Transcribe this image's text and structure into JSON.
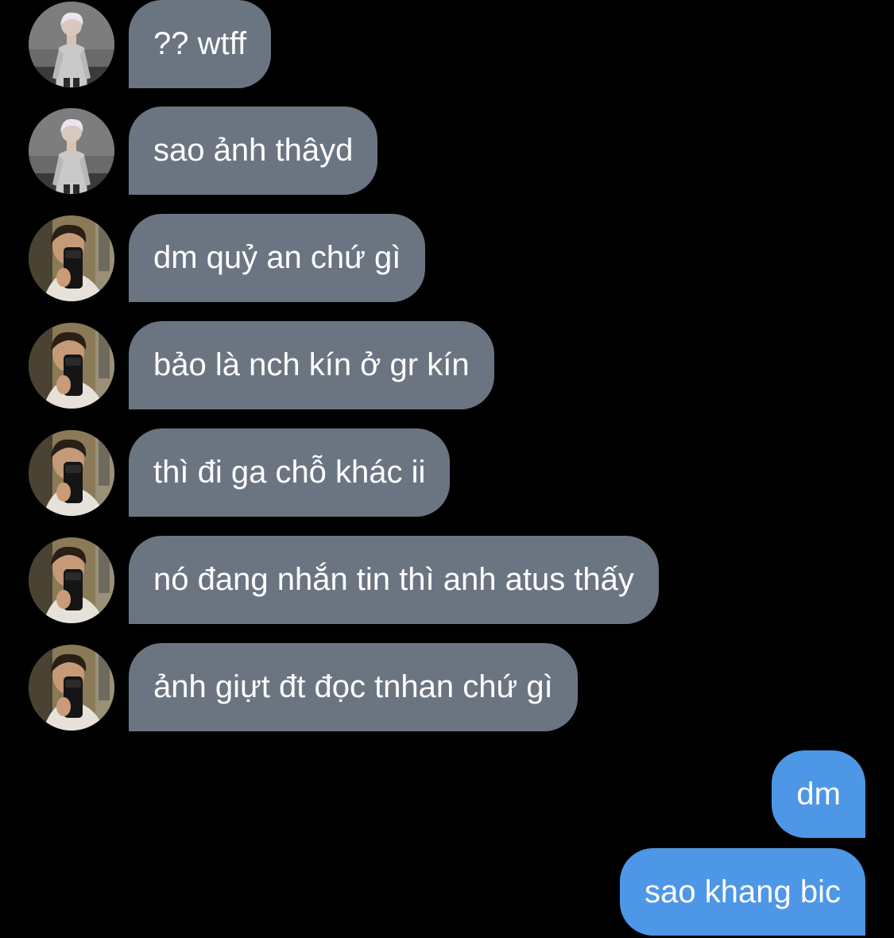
{
  "conversation": {
    "incoming": [
      {
        "text": "?? wtff",
        "avatar": "avatar-white-hair-icon"
      },
      {
        "text": "sao ảnh thâyd",
        "avatar": "avatar-white-hair-icon"
      },
      {
        "text": "dm quỷ an chứ gì",
        "avatar": "avatar-mirror-selfie-icon"
      },
      {
        "text": "bảo là nch kín ở gr kín",
        "avatar": "avatar-mirror-selfie-icon"
      },
      {
        "text": "thì đi ga chỗ khác ii",
        "avatar": "avatar-mirror-selfie-icon"
      },
      {
        "text": "nó đang nhắn tin thì anh atus thấy",
        "avatar": "avatar-mirror-selfie-icon"
      },
      {
        "text": "ảnh giựt đt đọc tnhan chứ gì",
        "avatar": "avatar-mirror-selfie-icon"
      }
    ],
    "outgoing": [
      {
        "text": "dm"
      },
      {
        "text": "sao khang bic"
      }
    ]
  },
  "colors": {
    "background": "#000000",
    "incoming_bubble": "#6b7582",
    "outgoing_bubble": "#4d97e6",
    "text": "#ffffff"
  }
}
